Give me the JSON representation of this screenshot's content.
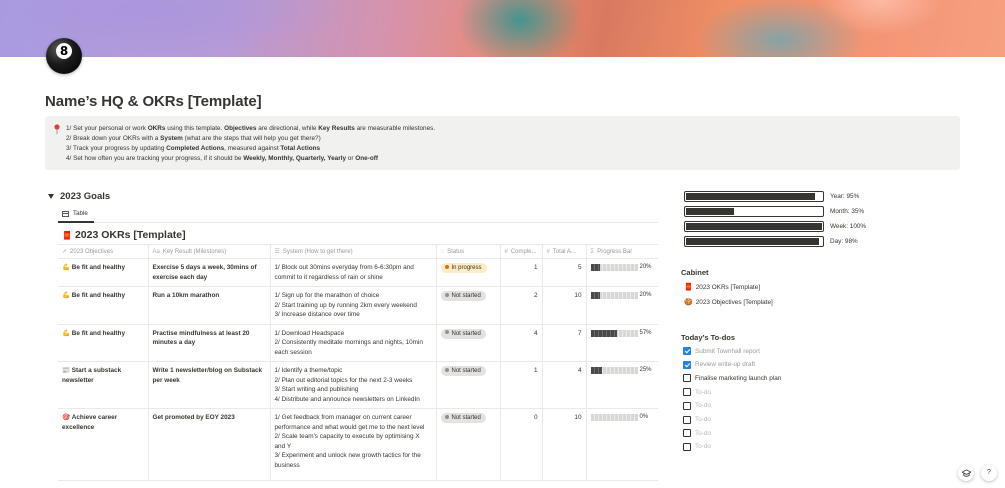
{
  "page": {
    "title": "Name’s HQ & OKRs [Template]"
  },
  "callout": {
    "icon": "pin-icon",
    "lines": [
      [
        {
          "t": "1/ Set your personal or work ",
          "b": false
        },
        {
          "t": "OKRs",
          "b": true
        },
        {
          "t": " using this template. ",
          "b": false
        },
        {
          "t": "Objectives",
          "b": true
        },
        {
          "t": " are directional, while ",
          "b": false
        },
        {
          "t": "Key Results",
          "b": true
        },
        {
          "t": " are measurable milestones.",
          "b": false
        }
      ],
      [
        {
          "t": "2/ Break down your OKRs with a ",
          "b": false
        },
        {
          "t": "System",
          "b": true
        },
        {
          "t": " (what are the steps that will help you get there?)",
          "b": false
        }
      ],
      [
        {
          "t": "3/ Track your progress by updating ",
          "b": false
        },
        {
          "t": "Completed Actions",
          "b": true
        },
        {
          "t": ", measured against ",
          "b": false
        },
        {
          "t": "Total Actions",
          "b": true
        }
      ],
      [
        {
          "t": "4/ Set how often you are tracking your progress, if it should be ",
          "b": false
        },
        {
          "t": "Weekly, Monthly, Quarterly, Yearly",
          "b": true
        },
        {
          "t": " or ",
          "b": false
        },
        {
          "t": "One-off",
          "b": true
        }
      ]
    ]
  },
  "goals": {
    "toggle_label": "2023 Goals",
    "view_tab": "Table",
    "db_emoji": "🧧",
    "db_title": "2023 OKRs [Template]",
    "columns": [
      "2023 Objectives",
      "Key Result (Milestones)",
      "System (How to get there)",
      "Status",
      "Comple...",
      "Total A...",
      "Progress Bar"
    ],
    "rows": [
      {
        "emoji": "💪",
        "objective": "Be fit and healthy",
        "key_result": "Exercise 5 days a week, 30mins of exercise each day",
        "system": [
          "1/ Block out 30mins everyday from 6-6:30pm and commit to it regardless of rain or shine"
        ],
        "status": "In progress",
        "completed": "1",
        "total": "5",
        "progress": 0.2,
        "progress_label": "20%"
      },
      {
        "emoji": "💪",
        "objective": "Be fit and healthy",
        "key_result": "Run a 10km marathon",
        "system": [
          "1/ Sign up for the marathon of choice",
          "2/ Start training up by running 2km every weekend",
          "3/ Increase distance over time"
        ],
        "status": "Not started",
        "completed": "2",
        "total": "10",
        "progress": 0.2,
        "progress_label": "20%"
      },
      {
        "emoji": "💪",
        "objective": "Be fit and healthy",
        "key_result": "Practise mindfulness at least 20 minutes a day",
        "system": [
          "1/ Download Headspace",
          "2/ Consistently meditate mornings and nights, 10min each session"
        ],
        "status": "Not started",
        "completed": "4",
        "total": "7",
        "progress": 0.57,
        "progress_label": "57%"
      },
      {
        "emoji": "📰",
        "objective": "Start a substack newsletter",
        "key_result": "Write 1 newsletter/blog on Substack per week",
        "system": [
          "1/ Identify a theme/topic",
          "2/ Plan out editorial topics for the next 2-3 weeks",
          "3/ Start writing and publishing",
          "4/ Distribute and announce newsletters on LinkedIn"
        ],
        "status": "Not started",
        "completed": "1",
        "total": "4",
        "progress": 0.25,
        "progress_label": "25%"
      },
      {
        "emoji": "🎯",
        "objective": "Achieve career excellence",
        "key_result": "Get promoted by EOY 2023",
        "system": [
          "1/ Get feedback from manager on current career performance and what would get me to the next level",
          "2/ Scale team's capacity to execute by optimising X and Y",
          "3/ Experiment and unlock new growth tactics for the business"
        ],
        "status": "Not started",
        "completed": "0",
        "total": "10",
        "progress": 0.0,
        "progress_label": "0%"
      }
    ]
  },
  "status_colors": {
    "In progress": {
      "bg": "#fdecc8",
      "dot": "#d9730d",
      "text": "#402c1b"
    },
    "Not started": {
      "bg": "#e3e2e0",
      "dot": "#91918e",
      "text": "#32302c"
    }
  },
  "progress_widget": [
    {
      "label": "Year: 95%",
      "value": 0.95
    },
    {
      "label": "Month: 35%",
      "value": 0.35
    },
    {
      "label": "Week: 100%",
      "value": 1.0
    },
    {
      "label": "Day: 98%",
      "value": 0.98
    }
  ],
  "cabinet": {
    "heading": "Cabinet",
    "items": [
      {
        "emoji": "🧧",
        "label": "2023 OKRs [Template]"
      },
      {
        "emoji": "🍪",
        "label": "2023 Objectives [Template]"
      }
    ]
  },
  "todos": {
    "heading": "Today’s To-dos",
    "items": [
      {
        "label": "Submit Townhall report",
        "checked": true
      },
      {
        "label": "Review write-up draft",
        "checked": true
      },
      {
        "label": "Finalise marketing launch plan",
        "checked": false
      },
      {
        "label": "To-do",
        "checked": false,
        "placeholder": true
      },
      {
        "label": "To-do",
        "checked": false,
        "placeholder": true
      },
      {
        "label": "To-do",
        "checked": false,
        "placeholder": true
      },
      {
        "label": "To-do",
        "checked": false,
        "placeholder": true
      },
      {
        "label": "To-do",
        "checked": false,
        "placeholder": true
      }
    ]
  },
  "floating": {
    "help_label": "?",
    "help_icon": "question-icon",
    "updates_icon": "graduation-cap-icon"
  }
}
